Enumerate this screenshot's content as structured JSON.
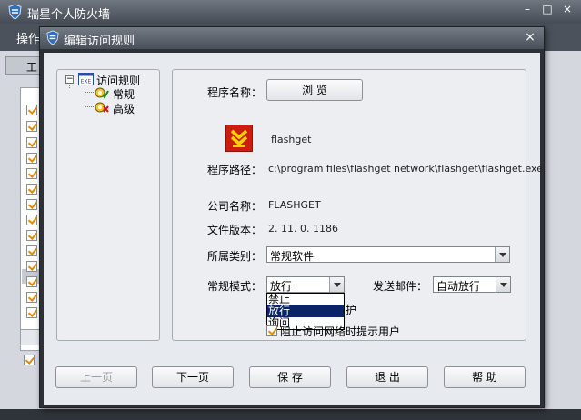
{
  "main_window": {
    "title": "瑞星个人防火墙",
    "menu_label": "操作",
    "tab_label": "工",
    "controls": {
      "minimize": "–",
      "maximize": "□",
      "close": "×"
    }
  },
  "dialog": {
    "title": "编辑访问规则",
    "close": "×",
    "tree": {
      "root": {
        "label": "访问规则",
        "expander": "−",
        "badge": "EXE"
      },
      "children": [
        {
          "label": "常规"
        },
        {
          "label": "高级"
        }
      ]
    },
    "form": {
      "program_name_label": "程序名称：",
      "browse_label": "浏 览",
      "program_name": "flashget",
      "program_path_label": "程序路径：",
      "program_path": "c:\\program files\\flashget network\\flashget\\flashget.exe",
      "company_label": "公司名称：",
      "company": "FLASHGET",
      "version_label": "文件版本：",
      "version": "2. 11. 0. 1186",
      "category_label": "所属类别：",
      "category_value": "常规软件",
      "mode_label": "常规模式：",
      "mode_value": "放行",
      "mode_options": [
        "禁止",
        "放行",
        "询问"
      ],
      "mode_selected_index": 1,
      "protect_tail": "护",
      "email_label": "发送邮件：",
      "email_value": "自动放行",
      "block_notify_label": "阻止访问网络时提示用户",
      "block_notify_checked": true
    },
    "buttons": {
      "prev": "上一页",
      "next": "下一页",
      "save": "保 存",
      "exit": "退 出",
      "help": "帮 助"
    }
  }
}
